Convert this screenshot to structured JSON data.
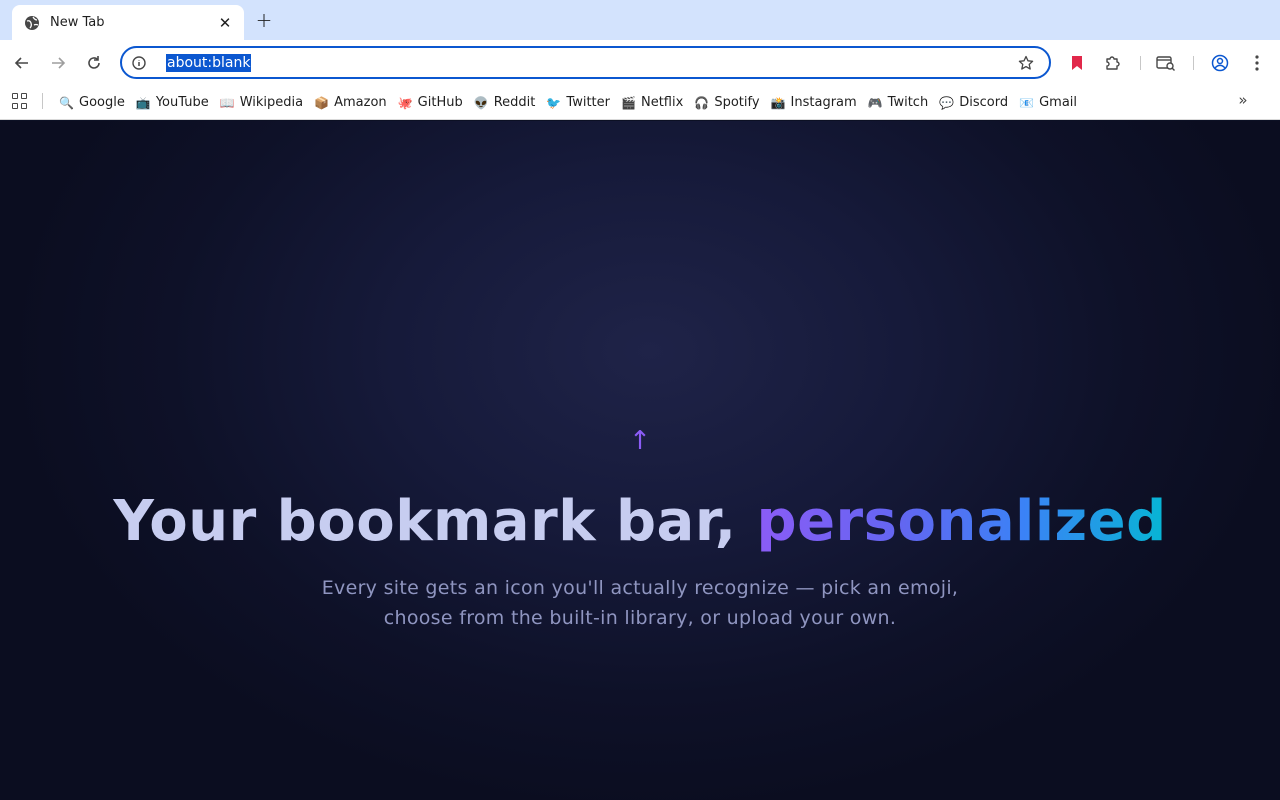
{
  "tab": {
    "title": "New Tab",
    "close": "✕",
    "new_tab": "+"
  },
  "toolbar": {
    "back": "←",
    "forward": "→",
    "reload": "↻",
    "url": "about:blank",
    "bookmark_ext_color": "#e1284a"
  },
  "bookmarks": {
    "items": [
      {
        "icon": "🔍",
        "label": "Google"
      },
      {
        "icon": "📺",
        "label": "YouTube"
      },
      {
        "icon": "📖",
        "label": "Wikipedia"
      },
      {
        "icon": "📦",
        "label": "Amazon"
      },
      {
        "icon": "🐙",
        "label": "GitHub"
      },
      {
        "icon": "👽",
        "label": "Reddit"
      },
      {
        "icon": "🐦",
        "label": "Twitter"
      },
      {
        "icon": "🎬",
        "label": "Netflix"
      },
      {
        "icon": "🎧",
        "label": "Spotify"
      },
      {
        "icon": "📸",
        "label": "Instagram"
      },
      {
        "icon": "🎮",
        "label": "Twitch"
      },
      {
        "icon": "💬",
        "label": "Discord"
      },
      {
        "icon": "📧",
        "label": "Gmail"
      }
    ],
    "more": "»"
  },
  "hero": {
    "arrow": "↑",
    "title_main": "Your bookmark bar, ",
    "title_accent": "personalized",
    "subtitle_line1": "Every site gets an icon you'll actually recognize — pick an emoji,",
    "subtitle_line2": "choose from the built-in library, or upload your own."
  },
  "colors": {
    "accent": "#0b57d0",
    "tabstrip": "#d3e3fd",
    "hero_gradient": [
      "#8b5cf6",
      "#3b82f6",
      "#06b6d4"
    ]
  }
}
